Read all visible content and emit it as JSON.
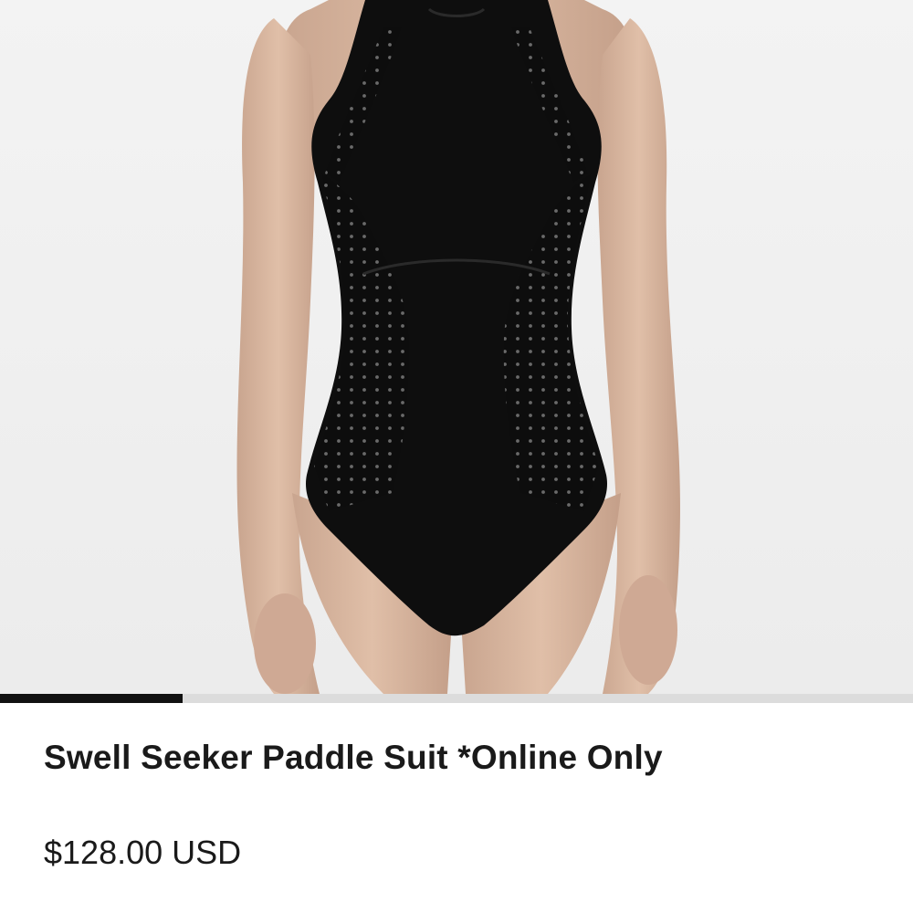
{
  "product": {
    "image_icon": "swimsuit-photo",
    "title": "Swell Seeker Paddle Suit *Online Only",
    "price": "$128.00 USD"
  },
  "carousel": {
    "progress_fraction": 0.2
  },
  "colors": {
    "background": "#ffffff",
    "image_background": "#f0f0f0",
    "text": "#1a1a1a",
    "progress_fill": "#111111",
    "progress_track": "#dcdcdc"
  }
}
